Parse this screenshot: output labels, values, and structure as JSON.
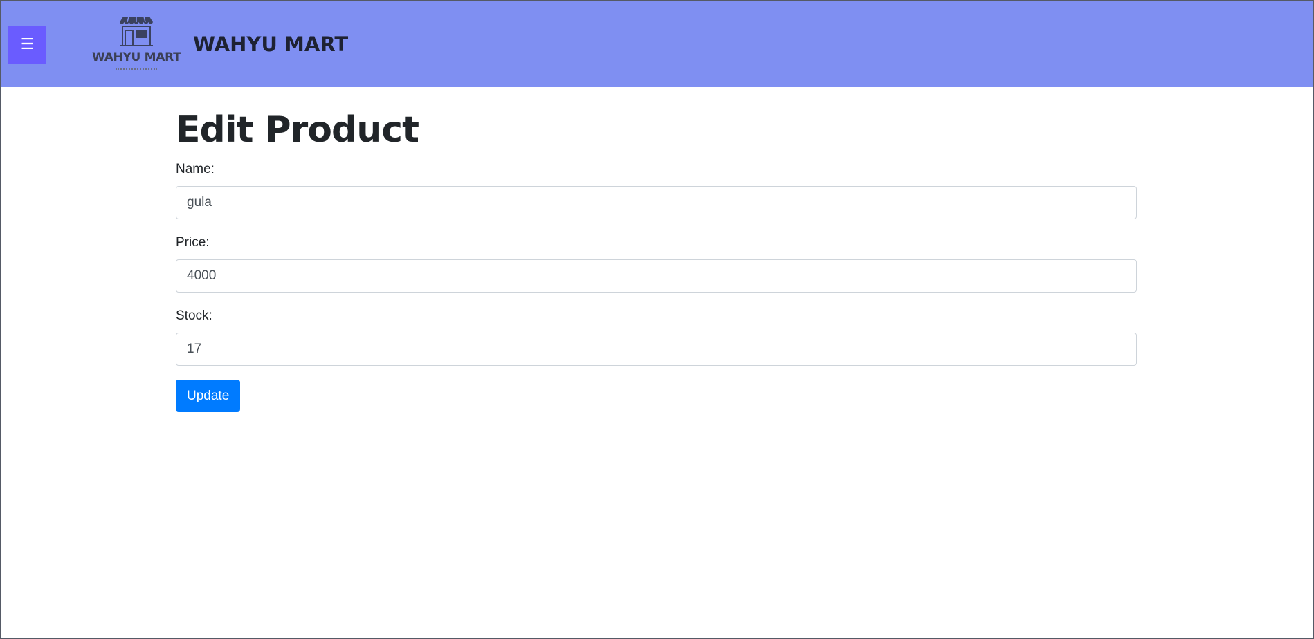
{
  "header": {
    "menu_icon": "hamburger-icon",
    "menu_glyph": "☰",
    "logo_icon": "storefront-icon",
    "logo_text": "WAHYU MART",
    "brand_name": "WAHYU MART",
    "background_color": "#7f8ff2",
    "menu_button_color": "#6a5cff"
  },
  "main": {
    "title": "Edit Product",
    "fields": {
      "name": {
        "label": "Name:",
        "value": "gula"
      },
      "price": {
        "label": "Price:",
        "value": "4000"
      },
      "stock": {
        "label": "Stock:",
        "value": "17"
      }
    },
    "submit_label": "Update",
    "submit_color": "#007bff"
  }
}
